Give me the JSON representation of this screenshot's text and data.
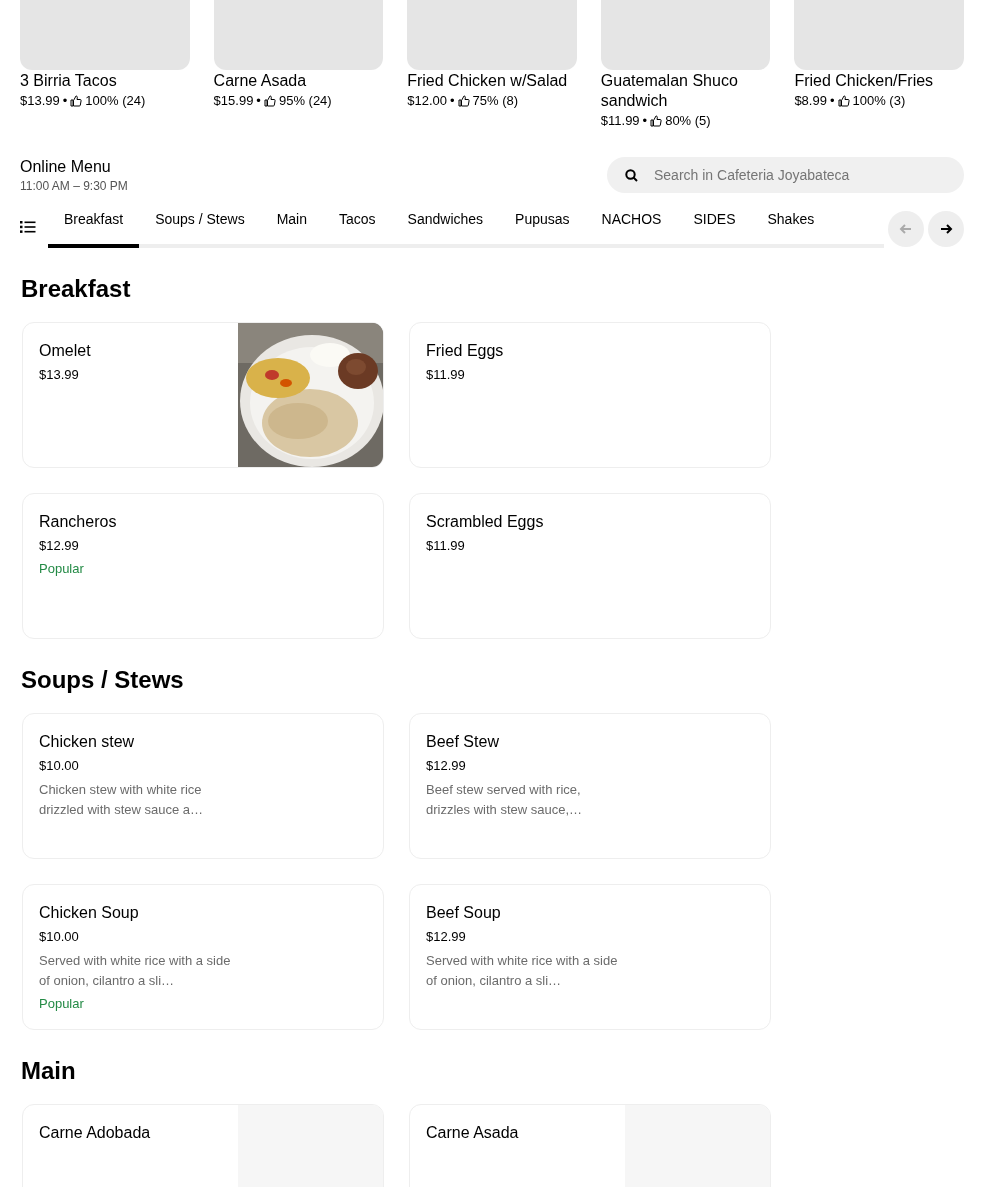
{
  "featured": [
    {
      "name": "3 Birria Tacos",
      "price": "$13.99",
      "separator": "•",
      "rating": "100% (24)"
    },
    {
      "name": "Carne Asada",
      "price": "$15.99",
      "separator": "•",
      "rating": "95% (24)"
    },
    {
      "name": "Fried Chicken w/Salad",
      "price": "$12.00",
      "separator": "•",
      "rating": "75% (8)"
    },
    {
      "name": "Guatemalan Shuco sandwich",
      "price": "$11.99",
      "separator": "•",
      "rating": "80% (5)"
    },
    {
      "name": "Fried Chicken/Fries",
      "price": "$8.99",
      "separator": "•",
      "rating": "100% (3)"
    }
  ],
  "menu_header": {
    "title": "Online Menu",
    "hours": "11:00 AM – 9:30 PM"
  },
  "search": {
    "placeholder": "Search in Cafeteria Joyabateca"
  },
  "categories": [
    {
      "label": "Breakfast",
      "selected": true
    },
    {
      "label": "Soups / Stews",
      "selected": false
    },
    {
      "label": "Main",
      "selected": false
    },
    {
      "label": "Tacos",
      "selected": false
    },
    {
      "label": "Sandwiches",
      "selected": false
    },
    {
      "label": "Pupusas",
      "selected": false
    },
    {
      "label": "NACHOS",
      "selected": false
    },
    {
      "label": "SIDES",
      "selected": false
    },
    {
      "label": "Shakes",
      "selected": false
    }
  ],
  "scroll_buttons": {
    "prev_disabled": true,
    "next_disabled": false
  },
  "sections": [
    {
      "title": "Breakfast",
      "items": [
        {
          "name": "Omelet",
          "price": "$13.99",
          "kind": "picture"
        },
        {
          "name": "Fried Eggs",
          "price": "$11.99"
        },
        {
          "name": "Rancheros",
          "price": "$12.99",
          "tag": "Popular"
        },
        {
          "name": "Scrambled Eggs",
          "price": "$11.99"
        }
      ]
    },
    {
      "title": "Soups / Stews",
      "items": [
        {
          "name": "Chicken stew",
          "price": "$10.00",
          "description": "Chicken stew with white rice drizzled with stew sauce a…"
        },
        {
          "name": "Beef Stew",
          "price": "$12.99",
          "description": "Beef stew served with rice, drizzles with stew sauce,…"
        },
        {
          "name": "Chicken Soup",
          "price": "$10.00",
          "description": "Served with white rice with a side of onion, cilantro a sli…",
          "tag": "Popular"
        },
        {
          "name": "Beef Soup",
          "price": "$12.99",
          "description": "Served with white rice with a side of onion, cilantro a sli…"
        }
      ]
    },
    {
      "title": "Main",
      "items": [
        {
          "name": "Carne Adobada",
          "kind": "placeholder"
        },
        {
          "name": "Carne Asada",
          "kind": "placeholder"
        }
      ]
    }
  ]
}
